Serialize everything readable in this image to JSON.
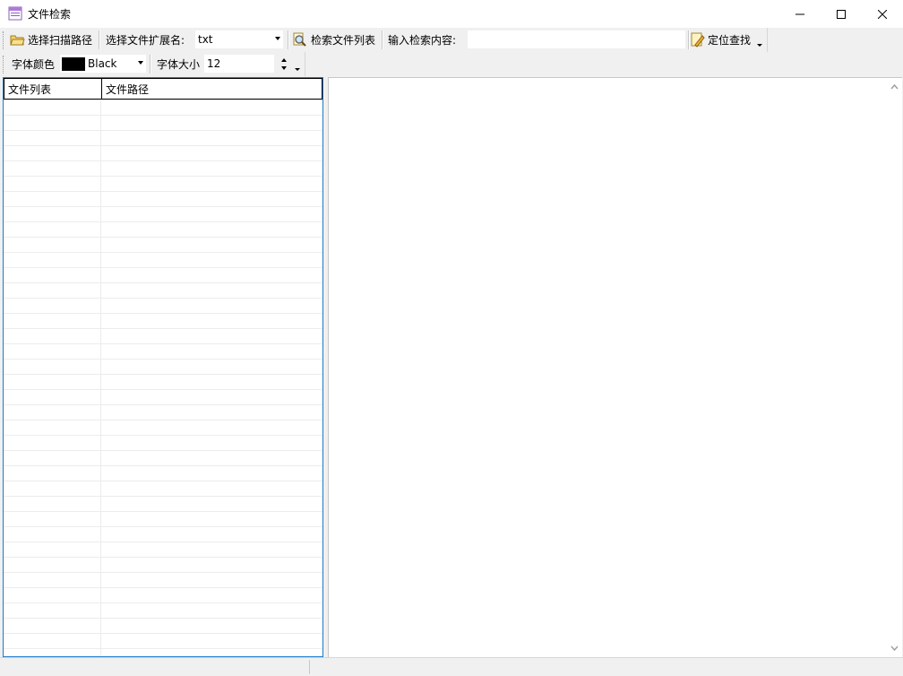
{
  "window": {
    "title": "文件检索",
    "icon": "app-window-icon"
  },
  "toolbar1": {
    "scan_path_label": "选择扫描路径",
    "extension_label": "选择文件扩展名:",
    "extension_value": "txt",
    "search_list_label": "检索文件列表",
    "search_content_label": "输入检索内容:",
    "search_content_value": "",
    "locate_label": "定位查找"
  },
  "toolbar2": {
    "font_color_label": "字体颜色",
    "font_color_value": "Black",
    "font_color_swatch": "#000000",
    "font_size_label": "字体大小",
    "font_size_value": "12"
  },
  "file_list": {
    "columns": [
      "文件列表",
      "文件路径"
    ],
    "rows": []
  },
  "colors": {
    "accent": "#1c7bc8"
  }
}
